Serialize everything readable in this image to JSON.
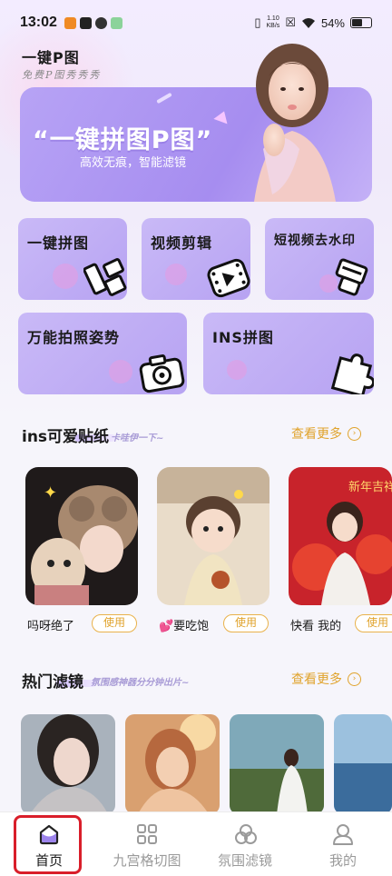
{
  "status_bar": {
    "time": "13:02",
    "net_speed_value": "1.10",
    "net_speed_unit": "KB/s",
    "battery": "54%"
  },
  "header": {
    "title": "一键P图",
    "subtitle": "免费P图秀秀秀"
  },
  "banner": {
    "headline": "“一键拼图P图”",
    "tagline": "高效无痕，智能滤镜"
  },
  "features": [
    {
      "label": "一键拼图",
      "icon": "collage-icon"
    },
    {
      "label": "视频剪辑",
      "icon": "video-edit-icon"
    },
    {
      "label": "短视频去水印",
      "icon": "watermark-remove-icon"
    },
    {
      "label": "万能拍照姿势",
      "icon": "camera-icon"
    },
    {
      "label": "INS拼图",
      "icon": "puzzle-icon"
    }
  ],
  "stickers": {
    "title": "ins可爱贴纸",
    "subtitle": "卡哇伊一下~",
    "more": "查看更多",
    "items": [
      {
        "caption": "吗呀绝了",
        "button": "使用"
      },
      {
        "caption": "💕要吃饱",
        "button": "使用"
      },
      {
        "caption": "快看 我的",
        "button": "使用"
      }
    ]
  },
  "filters": {
    "title": "热门滤镜",
    "subtitle": "氛围感神器分分钟出片~",
    "more": "查看更多"
  },
  "nav": [
    {
      "label": "首页",
      "icon": "home-icon",
      "active": true
    },
    {
      "label": "九宫格切图",
      "icon": "grid-icon",
      "active": false
    },
    {
      "label": "氛围滤镜",
      "icon": "filter-icon",
      "active": false
    },
    {
      "label": "我的",
      "icon": "profile-icon",
      "active": false
    }
  ],
  "colors": {
    "accent": "#b7a3f2",
    "more_link": "#e0a32c",
    "highlight": "#d91e2a"
  }
}
